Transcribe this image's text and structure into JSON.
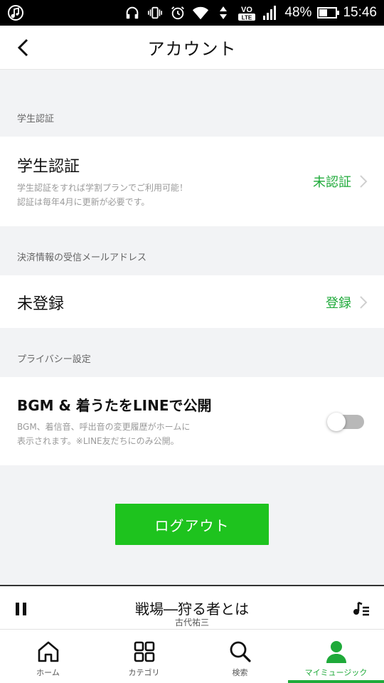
{
  "status_bar": {
    "battery": "48%",
    "time": "15:46",
    "battery_level": 0.48,
    "icons": [
      "music-note-icon",
      "headphones-icon",
      "vibrate-icon",
      "alarm-icon",
      "wifi-icon",
      "volte-icon",
      "signal-icon",
      "battery-icon"
    ],
    "volte": "VO LTE"
  },
  "header": {
    "title": "アカウント",
    "back_icon": "back-arrow-icon"
  },
  "sections": {
    "student": {
      "label": "学生認証",
      "title": "学生認証",
      "sub1": "学生認証をすれば学割プランでご利用可能！",
      "sub2": "認証は毎年4月に更新が必要です。",
      "status": "未認証"
    },
    "payment": {
      "label": "決済情報の受信メールアドレス",
      "title": "未登録",
      "action": "登録"
    },
    "privacy": {
      "label": "プライバシー設定",
      "title": "BGM & 着うたをLINEで公開",
      "sub1": "BGM、着信音、呼出音の変更履歴がホームに",
      "sub2": "表示されます。※LINE友だちにのみ公開。",
      "toggle_on": false
    }
  },
  "logout_label": "ログアウト",
  "player": {
    "song": "戦場―狩る者とは",
    "artist": "古代祐三"
  },
  "nav": {
    "items": [
      {
        "label": "ホーム",
        "icon": "home-icon"
      },
      {
        "label": "カテゴリ",
        "icon": "grid-icon"
      },
      {
        "label": "検索",
        "icon": "search-icon"
      },
      {
        "label": "マイミュージック",
        "icon": "person-icon"
      }
    ],
    "active_index": 3
  },
  "colors": {
    "accent_green": "#1faa3a",
    "logout_green": "#1ec31e"
  }
}
